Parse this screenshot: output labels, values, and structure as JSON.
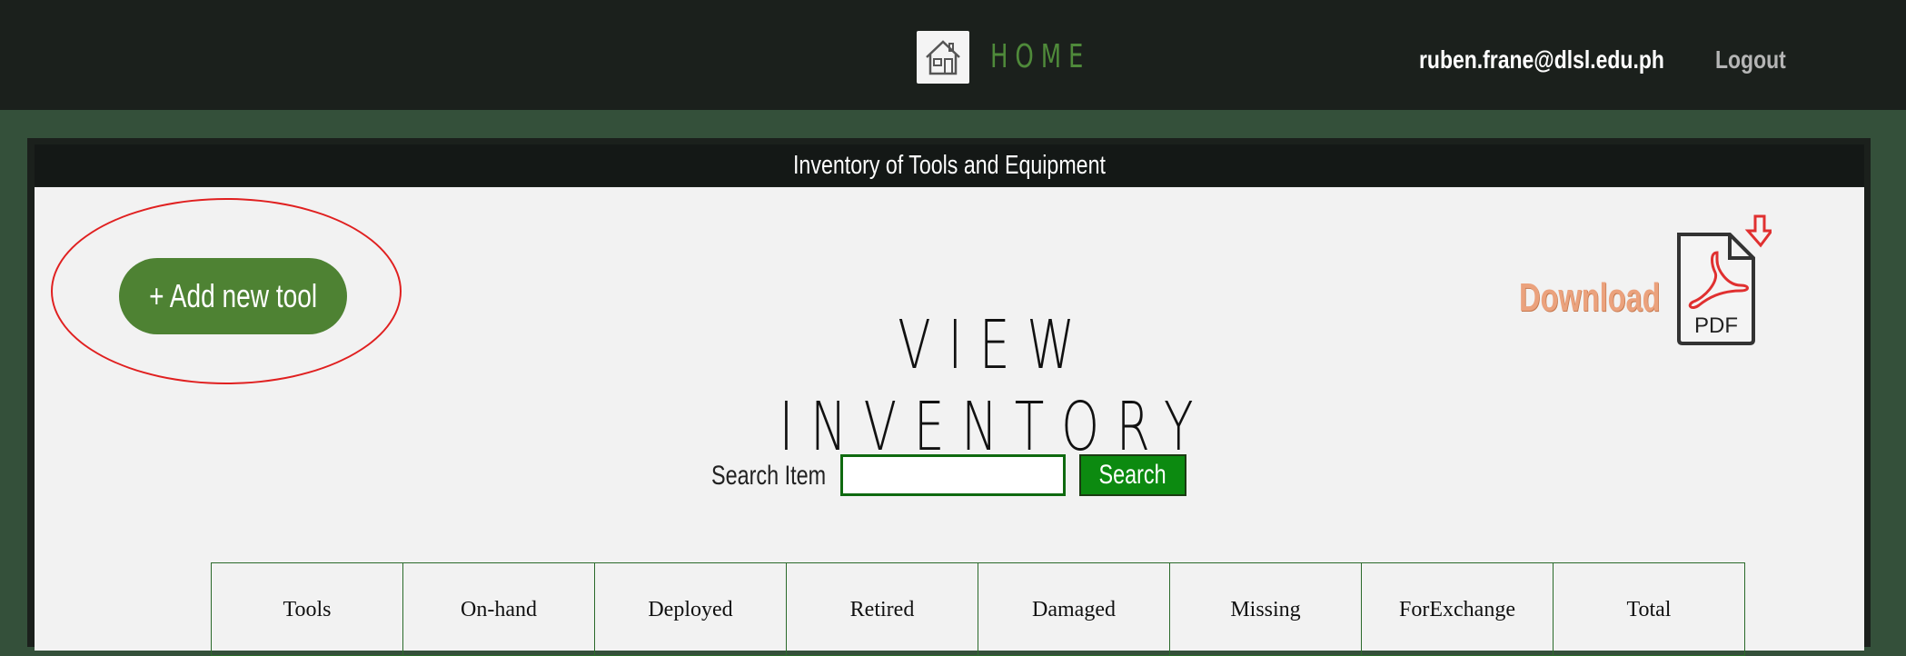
{
  "header": {
    "home_label": "HOME",
    "user_email": "ruben.frane@dlsl.edu.ph",
    "logout_label": "Logout"
  },
  "panel": {
    "title": "Inventory of Tools and Equipment"
  },
  "main": {
    "add_tool_label": "+ Add new tool",
    "page_heading": "VIEW INVENTORY",
    "download_label": "Download",
    "pdf_label": "PDF"
  },
  "search": {
    "label": "Search Item",
    "value": "",
    "button_label": "Search"
  },
  "table": {
    "columns": [
      "Tools",
      "On-hand",
      "Deployed",
      "Retired",
      "Damaged",
      "Missing",
      "ForExchange",
      "Total"
    ]
  },
  "colors": {
    "topbar": "#1b201c",
    "background": "#34503a",
    "accent_green": "#4e8233",
    "search_green": "#0c8a10",
    "highlight": "#e02020",
    "download": "#eba27d"
  },
  "icons": {
    "home": "house-icon",
    "pdf": "pdf-download-icon"
  }
}
